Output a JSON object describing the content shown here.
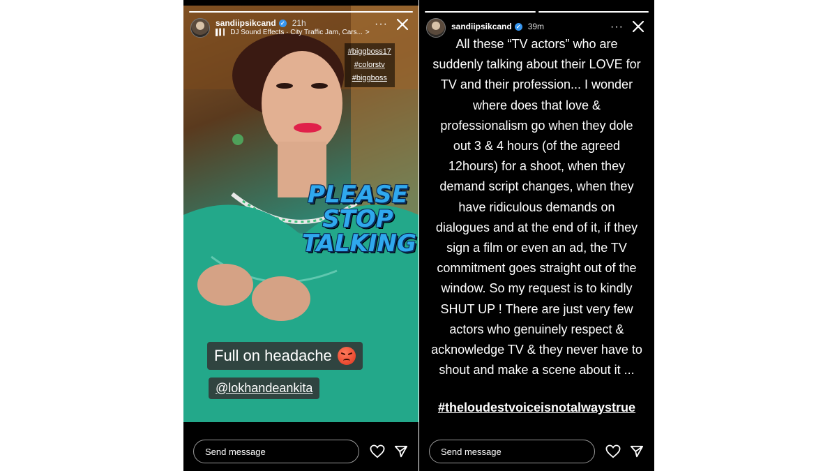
{
  "left_story": {
    "username": "sandiipsikcand",
    "time": "21h",
    "music": "DJ Sound Effects · City Traffic Jam, Cars...",
    "music_chevron": ">",
    "more": "···",
    "hashtags": [
      "#biggboss17",
      "#colorstv",
      "#biggboss"
    ],
    "sticker_lines": [
      "PLEASE",
      "STOP",
      "TALKING"
    ],
    "caption": "Full on headache",
    "caption_icon": "angry-face-icon",
    "mention": "@lokhandeankita",
    "send_placeholder": "Send message"
  },
  "right_story": {
    "username": "sandiipsikcand",
    "time": "39m",
    "more": "···",
    "lines": [
      "All these “TV actors” who are",
      "suddenly talking about their LOVE for",
      "TV and their profession... I wonder",
      "where does that love &",
      "professionalism go when they dole",
      "out 3 & 4 hours (of the agreed",
      "12hours) for a shoot, when they",
      "demand script changes, when they",
      "have ridiculous demands on",
      "dialogues and at the end of it, if they",
      "sign a film or even an ad, the TV",
      "commitment goes straight out of the",
      "window. So my request is to kindly",
      "SHUT UP ! There are just very few",
      "actors who genuinely  respect &",
      "acknowledge TV &  they never have to",
      "shout and make a scene about it ..."
    ],
    "hashtag": "#theloudestvoiceisnotalwaystrue",
    "send_placeholder": "Send message"
  },
  "colors": {
    "background": "#ffffff",
    "story_bg": "#000000",
    "sticker_text": "#2fa8ee",
    "verified_badge": "#3897f0"
  },
  "icons": [
    "verified-badge-icon",
    "music-bars-icon",
    "more-icon",
    "close-icon",
    "heart-icon",
    "send-plane-icon"
  ]
}
